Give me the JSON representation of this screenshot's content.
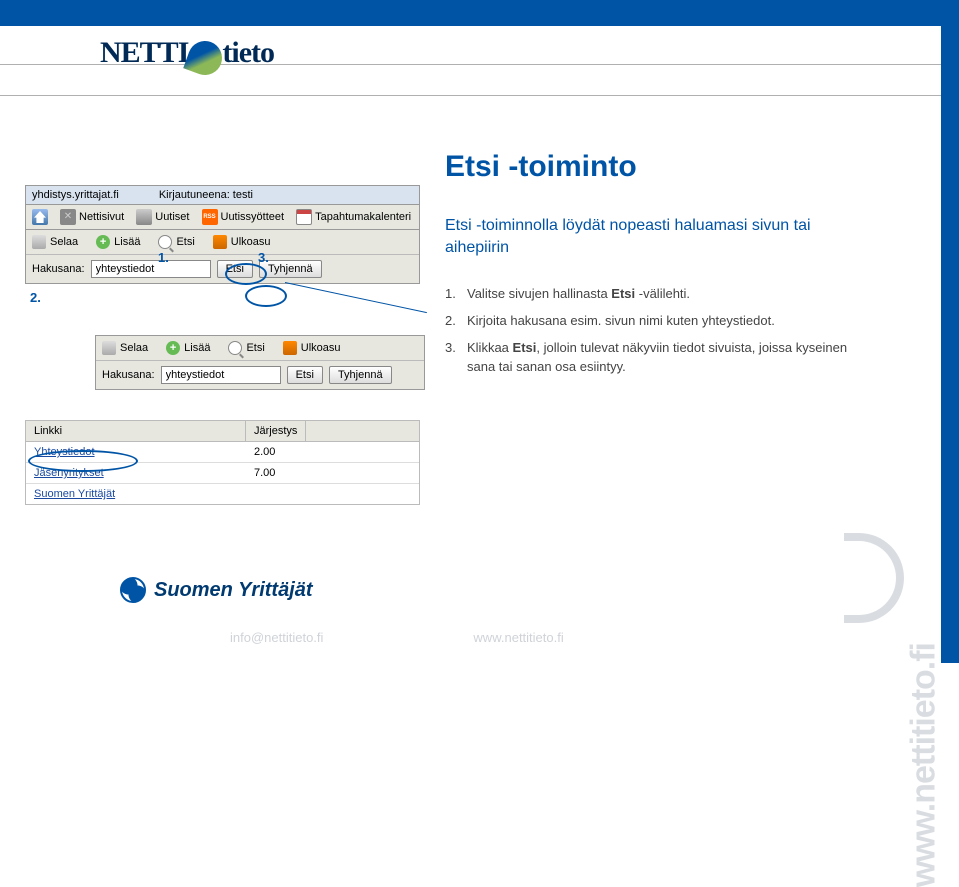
{
  "brand": {
    "left": "NETTI",
    "right": "tieto",
    "side_url": "www.nettitieto.fi"
  },
  "page": {
    "title": "Etsi -toiminto",
    "intro": "Etsi -toiminnolla löydät nopeasti haluamasi sivun tai aihepiirin",
    "steps": [
      {
        "num": "1.",
        "text_a": "Valitse sivujen hallinasta ",
        "bold": "Etsi",
        "text_b": " -välilehti."
      },
      {
        "num": "2.",
        "text_a": "Kirjoita hakusana esim. sivun nimi kuten yhteystiedot.",
        "bold": "",
        "text_b": ""
      },
      {
        "num": "3.",
        "text_a": "Klikkaa ",
        "bold": "Etsi",
        "text_b": ", jolloin tulevat näkyviin tiedot sivuista, joissa kyseinen sana tai sanan osa esiintyy."
      }
    ]
  },
  "markers": {
    "m1": "1.",
    "m2": "2.",
    "m3": "3."
  },
  "shotA": {
    "url": "yhdistys.yrittajat.fi",
    "logged": "Kirjautuneena: testi",
    "tabs": {
      "nettisivut": "Nettisivut",
      "uutiset": "Uutiset",
      "uutissyotteet": "Uutissyötteet",
      "kalenteri": "Tapahtumakalenteri"
    },
    "rss": "RSS"
  },
  "subtabs": {
    "selaa": "Selaa",
    "lisaa": "Lisää",
    "etsi": "Etsi",
    "ulkoasu": "Ulkoasu"
  },
  "search": {
    "label": "Hakusana:",
    "value": "yhteystiedot",
    "btn_search": "Etsi",
    "btn_clear": "Tyhjennä"
  },
  "results": {
    "col_link": "Linkki",
    "col_order": "Järjestys",
    "rows": [
      {
        "link": "Yhteystiedot",
        "order": "2.00"
      },
      {
        "link": "Jäsenyritykset",
        "order": "7.00"
      },
      {
        "link": "Suomen Yrittäjät",
        "order": ""
      }
    ]
  },
  "footer": {
    "org": "Suomen Yrittäjät",
    "link1": "info@nettitieto.fi",
    "link2": "www.nettitieto.fi"
  }
}
